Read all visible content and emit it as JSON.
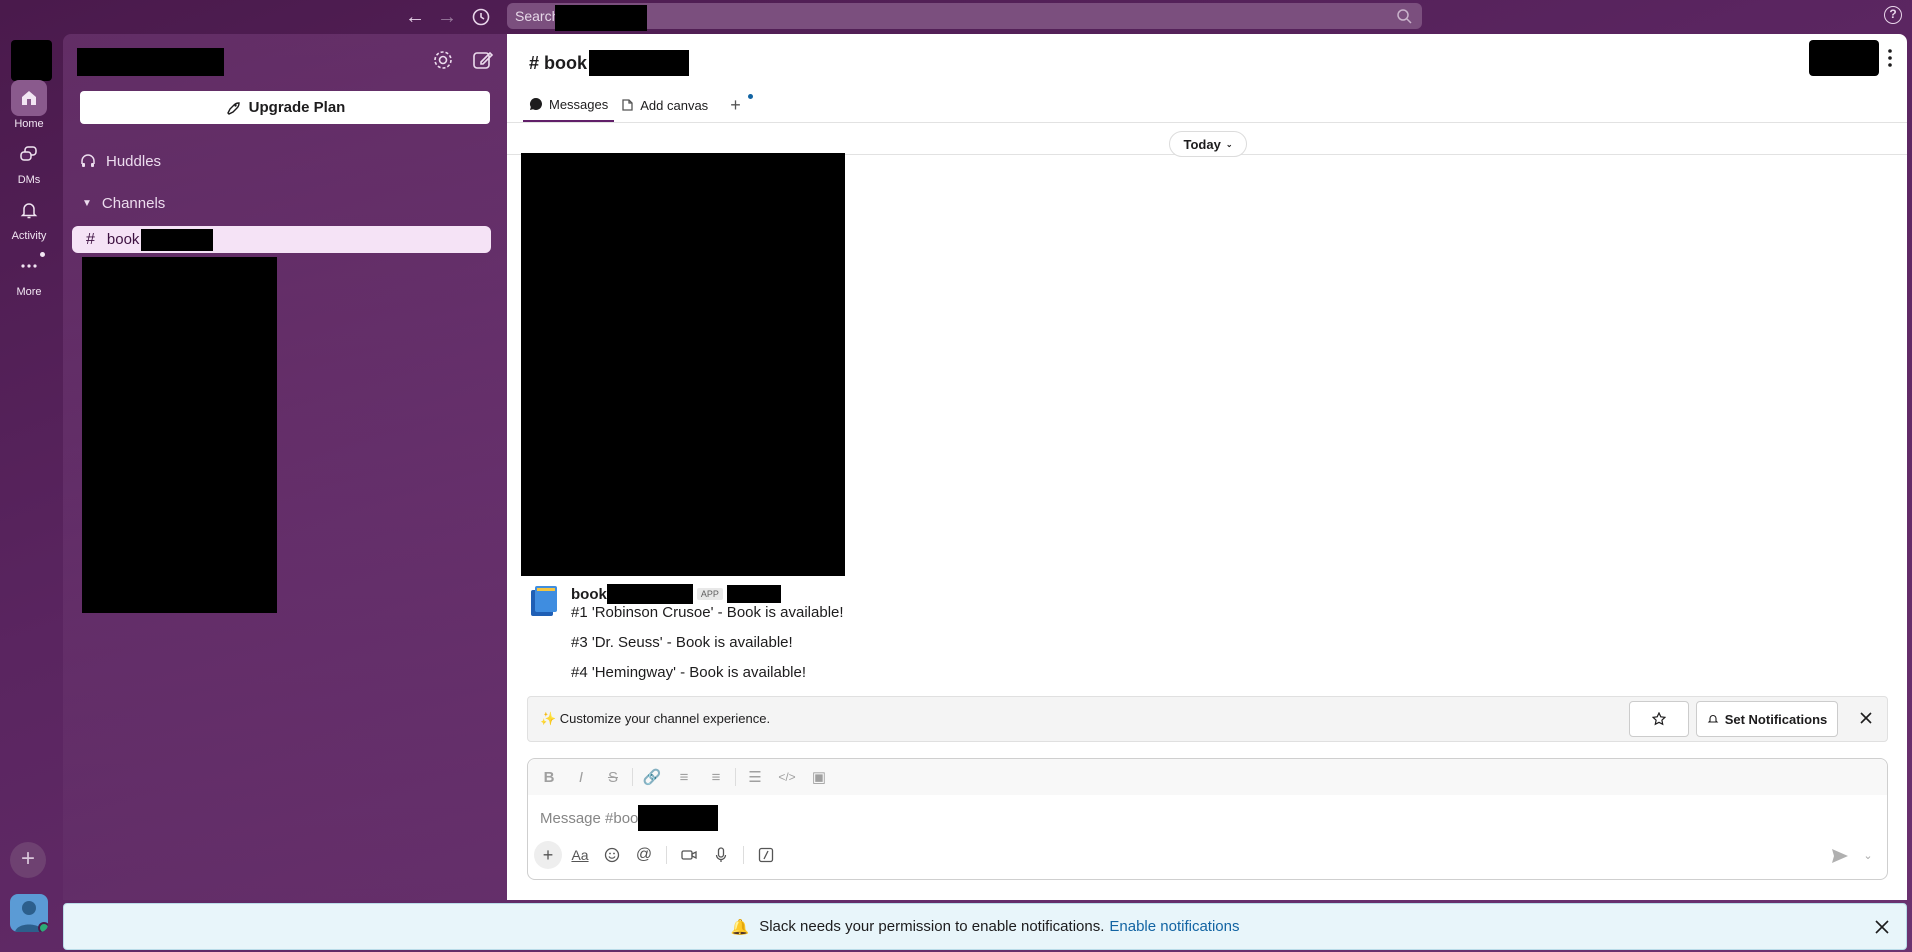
{
  "topbar": {
    "search_placeholder": "Search",
    "back_icon": "arrow-left-icon",
    "forward_icon": "arrow-right-icon",
    "history_icon": "clock-icon",
    "help_icon": "question-icon"
  },
  "rail": {
    "items": [
      {
        "label": "Home",
        "icon": "home-icon"
      },
      {
        "label": "DMs",
        "icon": "chat-bubbles-icon"
      },
      {
        "label": "Activity",
        "icon": "bell-icon"
      },
      {
        "label": "More",
        "icon": "ellipsis-icon"
      }
    ]
  },
  "sidebar": {
    "upgrade_label": "Upgrade Plan",
    "huddles_label": "Huddles",
    "channels_label": "Channels",
    "active_channel_prefix": "book"
  },
  "channel": {
    "title_prefix": "# book",
    "tabs": [
      {
        "label": "Messages"
      },
      {
        "label": "Add canvas"
      }
    ],
    "today_label": "Today"
  },
  "message": {
    "sender_prefix": "book",
    "badge": "APP",
    "lines": [
      "#1 'Robinson Crusoe' - Book is available!",
      "#3 'Dr. Seuss' - Book is available!",
      "#4 'Hemingway' - Book is available!"
    ]
  },
  "banner": {
    "text": "✨ Customize your channel experience.",
    "notif_label": "Set Notifications"
  },
  "composer": {
    "placeholder_prefix": "Message #boo"
  },
  "notify": {
    "bell": "🔔",
    "text": "Slack needs your permission to enable notifications.",
    "link": "Enable notifications"
  },
  "colors": {
    "brand": "#4a1a4c",
    "link": "#1264a3",
    "active_channel_bg": "#f5e3f6"
  }
}
